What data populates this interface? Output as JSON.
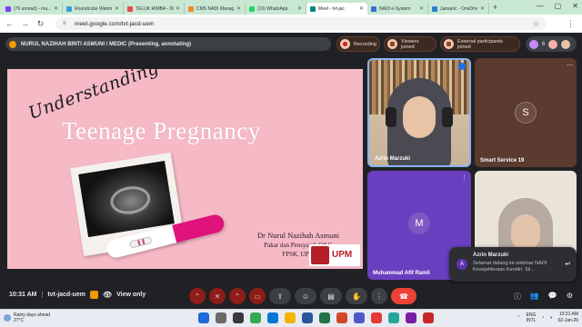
{
  "browser": {
    "tabs": [
      {
        "label": "(76 unread) - mu...",
        "color": "#7e3ff2"
      },
      {
        "label": "Roundcube Webm",
        "color": "#37a0d9"
      },
      {
        "label": "TELUK RIMBA - Di",
        "color": "#e34b4b"
      },
      {
        "label": "CMS NADI Manag",
        "color": "#f08c2a"
      },
      {
        "label": "(10) WhatsApp",
        "color": "#25d366"
      },
      {
        "label": "Meet - tvt-jac",
        "color": "#00897b",
        "active": true
      },
      {
        "label": "NADI e-System",
        "color": "#3b6fd6"
      },
      {
        "label": "Jansaric - OneDriv",
        "color": "#2b7cd3"
      }
    ],
    "new_tab": "+",
    "url": "meet.google.com/tvt-jacd-uem"
  },
  "meet": {
    "presenter_banner": "NURUL NAZIHAH BINTI ASMUNI / MEDIC (Presenting, annotating)",
    "recording_label": "Recording",
    "viewers_label": "Viewers joined",
    "external_label": "External participants joined",
    "people_count": "6"
  },
  "slide": {
    "script_word": "Understanding",
    "title": "Teenage Pregnancy",
    "author_name": "Dr Nurul Nazihah Asmuni",
    "author_role": "Pakar dan Pensyarah O&G",
    "author_faculty": "FPSK, UPM",
    "logo_text": "UPM"
  },
  "participants": [
    {
      "name": "Azrin Marzuki"
    },
    {
      "name": "Smart Service 19",
      "initial": "S",
      "avatar_color": "#6d4c41"
    },
    {
      "name": "Muhammad Afif Ramli",
      "initial": "M"
    },
    {
      "name": ""
    }
  ],
  "chat_toast": {
    "initial": "A",
    "sender": "Azrin Marzuki",
    "message": "Selamat datang ke webinar NADI Kesejahteraan Kendiri. Sil..."
  },
  "bottom": {
    "time": "10:31 AM",
    "separator": "|",
    "meeting_code": "tvt-jacd-uem",
    "view_only": "View only"
  },
  "taskbar": {
    "weather_line1": "Rainy days ahead",
    "weather_line2": "27°C",
    "lang1": "ENG",
    "lang2": "INTL",
    "clock_time": "10:31 AM",
    "clock_date": "02-Jan-26"
  }
}
